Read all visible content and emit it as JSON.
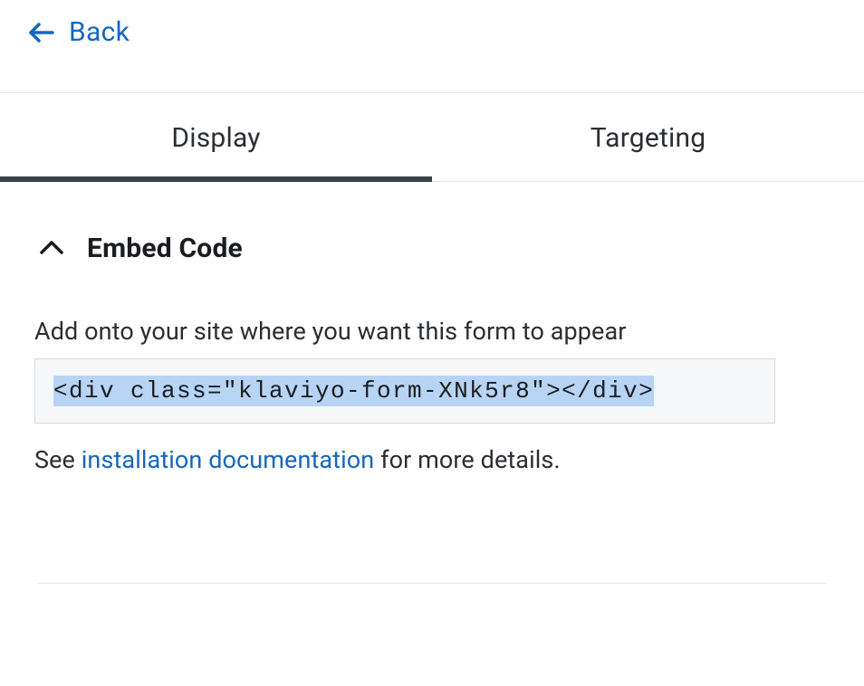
{
  "nav": {
    "back_label": "Back"
  },
  "tabs": {
    "display": "Display",
    "targeting": "Targeting"
  },
  "embed": {
    "section_title": "Embed Code",
    "label": "Add onto your site where you want this form to appear",
    "code": "<div class=\"klaviyo-form-XNk5r8\"></div>",
    "help_prefix": "See ",
    "help_link": "installation documentation",
    "help_suffix": " for more details."
  }
}
